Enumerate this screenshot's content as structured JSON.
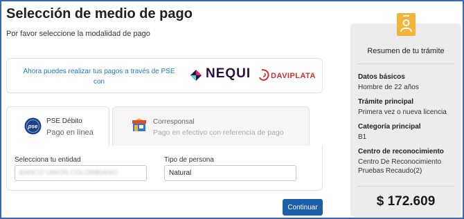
{
  "page": {
    "title": "Selección de medio de pago",
    "subtitle": "Por favor seleccione la modalidad de pago"
  },
  "promo": {
    "text": "Ahora puedes realizar tus pagos a través de PSE con",
    "brand_nequi": "NEQUI",
    "brand_daviplata": "DAVIPLATA"
  },
  "tabs": [
    {
      "title": "PSE Débito",
      "subtitle": "Pago en línea",
      "icon": "pse-icon",
      "selected": true
    },
    {
      "title": "Corresponsal",
      "subtitle": "Pago en efectivo con referencia de pago",
      "icon": "store-icon",
      "selected": false
    }
  ],
  "form": {
    "entity_label": "Selecciona tu entidad",
    "entity_value": "BANCO UNION COLOMBIANO",
    "person_type_label": "Tipo de persona",
    "person_type_value": "Natural"
  },
  "actions": {
    "continue_label": "Continuar"
  },
  "summary": {
    "title": "Resumen de tu trámite",
    "items": [
      {
        "label": "Datos básicos",
        "value": "Hombre de 22 años"
      },
      {
        "label": "Trámite principal",
        "value": "Primera vez o nueva licencia"
      },
      {
        "label": "Categoría principal",
        "value": "B1"
      },
      {
        "label": "Centro de reconocimiento",
        "value": "Centro De Reconocimiento Pruebas Recaudo(2)"
      }
    ],
    "total": "$ 172.609"
  },
  "colors": {
    "accent_blue": "#1d5fa8",
    "link_blue": "#1f7ac4",
    "summary_bg": "#ececec",
    "icon_yellow": "#f2b43a",
    "nequi_purple": "#2a0f3e",
    "daviplata_red": "#d0302a"
  }
}
